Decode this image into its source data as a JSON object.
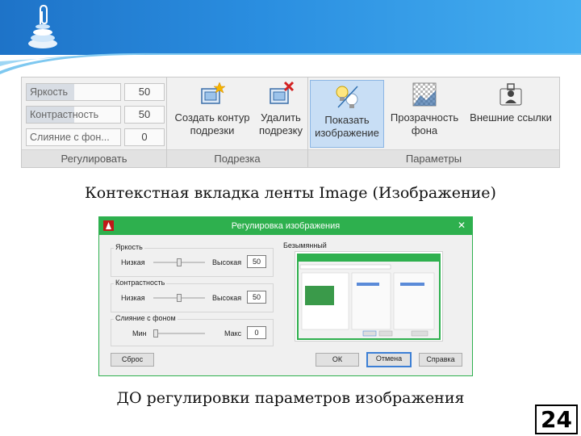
{
  "ribbon": {
    "adjust": {
      "rows": [
        {
          "label": "Яркость",
          "value": "50",
          "fill": 0.5
        },
        {
          "label": "Контрастность",
          "value": "50",
          "fill": 0.5
        },
        {
          "label": "Слияние с фон...",
          "value": "0",
          "fill": 0.0
        }
      ],
      "title": "Регулировать"
    },
    "clip": {
      "buttons": [
        {
          "label_line1": "Создать контур",
          "label_line2": "подрезки",
          "icon": "create-clip-icon"
        },
        {
          "label_line1": "Удалить",
          "label_line2": "подрезку",
          "icon": "delete-clip-icon"
        }
      ],
      "title": "Подрезка"
    },
    "options": {
      "buttons": [
        {
          "label_line1": "Показать",
          "label_line2": "изображение",
          "icon": "show-image-icon",
          "active": true
        },
        {
          "label_line1": "Прозрачность",
          "label_line2": "фона",
          "icon": "transparency-icon"
        },
        {
          "label_line1": "Внешние ссылки",
          "label_line2": "",
          "icon": "external-references-icon"
        }
      ],
      "title": "Параметры"
    }
  },
  "captions": {
    "top": "Контекстная вкладка ленты Image (Изображение)",
    "bottom": "ДО регулировки параметров изображения"
  },
  "dialog": {
    "title": "Регулировка изображения",
    "close": "✕",
    "brightness": {
      "title": "Яркость",
      "low": "Низкая",
      "high": "Высокая",
      "value": "50",
      "level": 0.5
    },
    "contrast": {
      "title": "Контрастность",
      "low": "Низкая",
      "high": "Высокая",
      "value": "50",
      "level": 0.5
    },
    "fade": {
      "title": "Слияние с фоном",
      "low": "Мин",
      "high": "Макс",
      "value": "0",
      "level": 0.0
    },
    "preview_title": "Безымянный",
    "reset": "Сброс",
    "ok": "ОК",
    "cancel": "Отмена",
    "help": "Справка"
  },
  "page_number": "24",
  "colors": {
    "accent_green": "#2eb04e",
    "header_blue": "#1e73c8"
  }
}
